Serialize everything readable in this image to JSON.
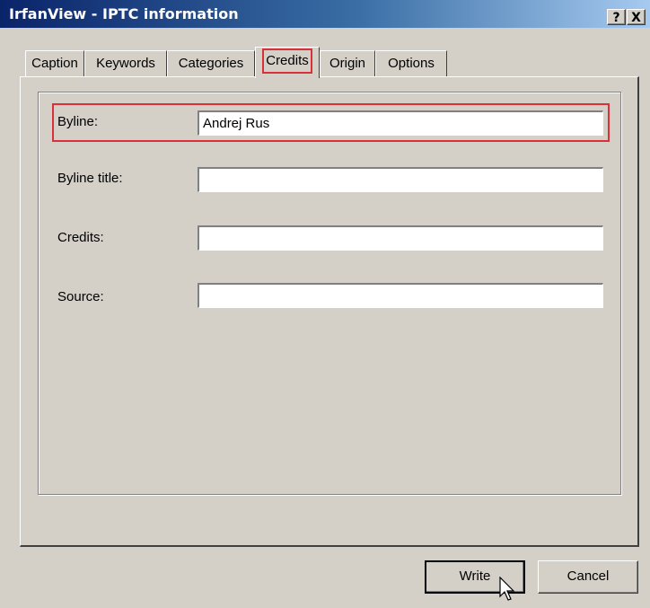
{
  "window": {
    "title": "IrfanView - IPTC information",
    "help_button": "?",
    "close_button": "X"
  },
  "tabs": [
    {
      "label": "Caption",
      "active": false
    },
    {
      "label": "Keywords",
      "active": false
    },
    {
      "label": "Categories",
      "active": false
    },
    {
      "label": "Credits",
      "active": true
    },
    {
      "label": "Origin",
      "active": false
    },
    {
      "label": "Options",
      "active": false
    }
  ],
  "fields": {
    "byline": {
      "label": "Byline:",
      "value": "Andrej Rus"
    },
    "byline_title": {
      "label": "Byline title:",
      "value": ""
    },
    "credits": {
      "label": "Credits:",
      "value": ""
    },
    "source": {
      "label": "Source:",
      "value": ""
    }
  },
  "buttons": {
    "write": "Write",
    "cancel": "Cancel"
  },
  "colors": {
    "highlight": "#d9303a",
    "titlebar_start": "#0a246a",
    "titlebar_end": "#a6caf0",
    "dialog_face": "#d4d0c8"
  },
  "icons": {
    "cursor": "arrow-cursor-icon"
  }
}
